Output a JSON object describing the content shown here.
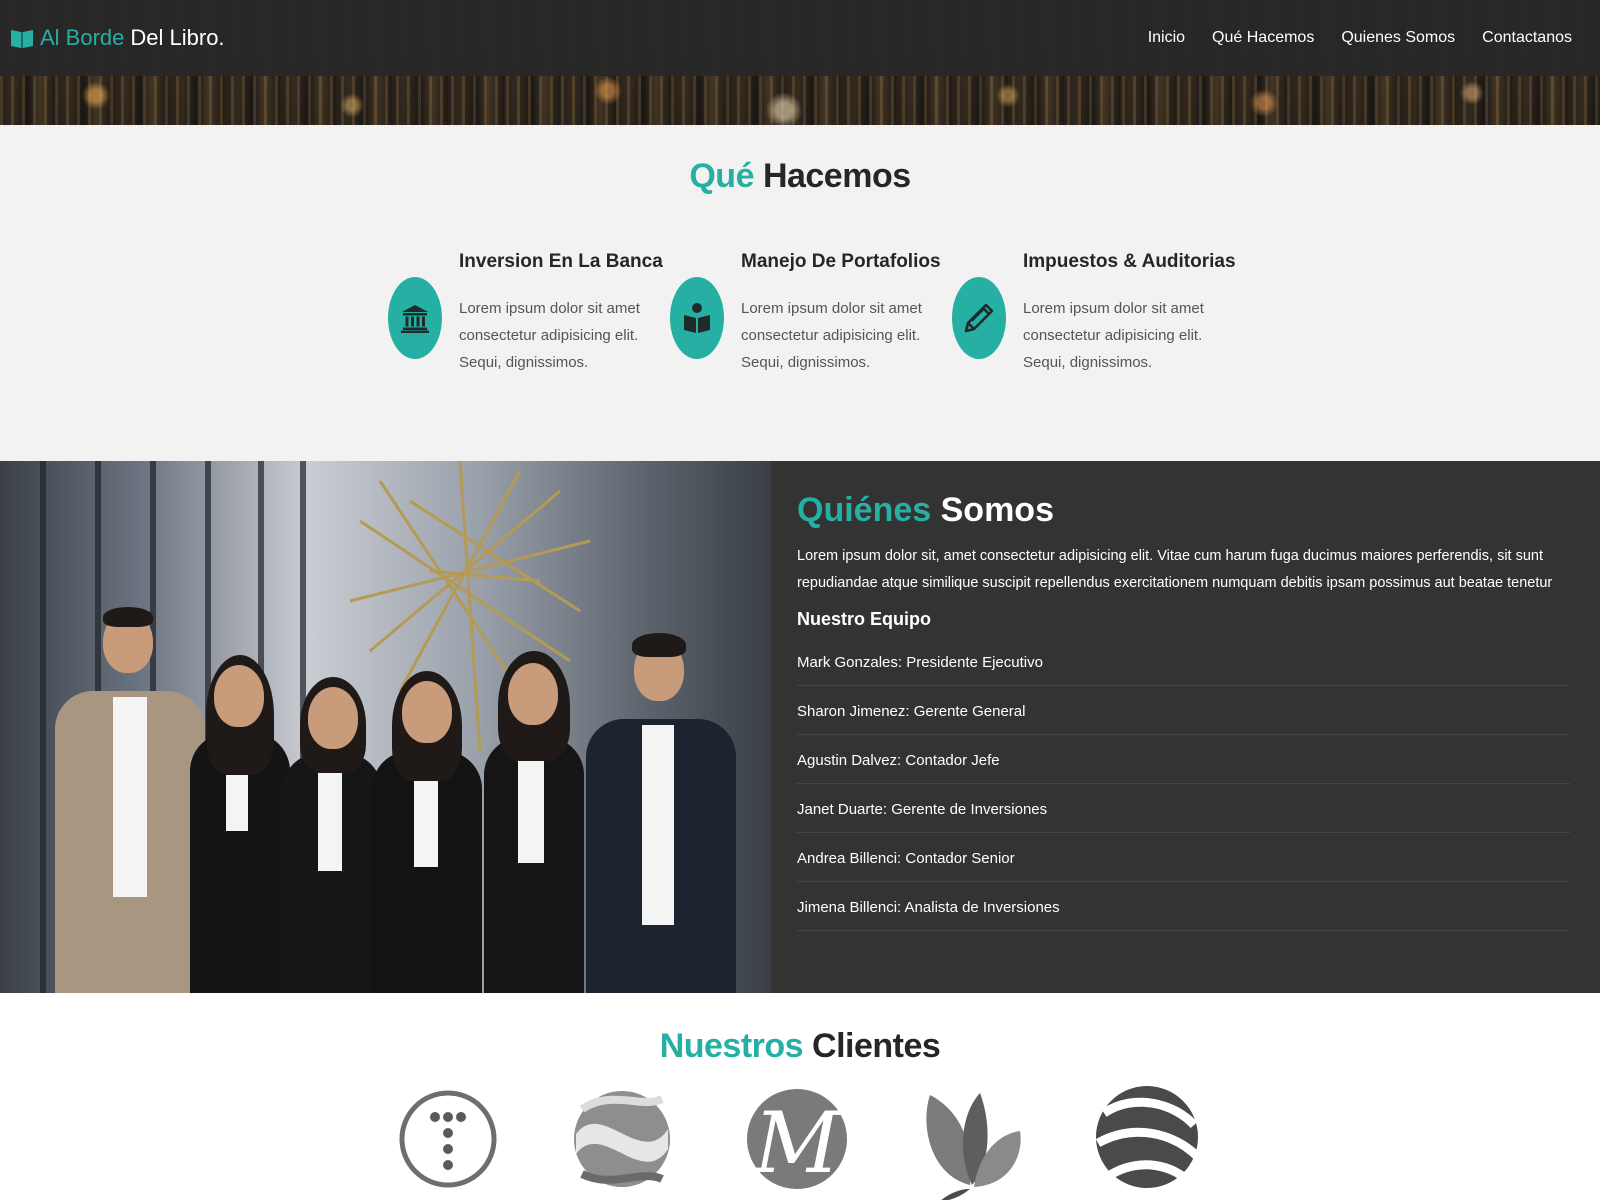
{
  "brand": {
    "accent": "Al Borde",
    "main": "Del Libro.",
    "icon": "open-book-icon"
  },
  "nav": {
    "items": [
      "Inicio",
      "Qué Hacemos",
      "Quienes Somos",
      "Contactanos"
    ]
  },
  "colors": {
    "accent": "#26b0a4",
    "navbar": "#282828",
    "about_bg": "#333333",
    "services_bg": "#f2f2f2"
  },
  "services": {
    "title_accent": "Qué",
    "title_main": "Hacemos",
    "items": [
      {
        "title": "Inversion En La Banca",
        "text": "Lorem ipsum dolor sit amet consectetur adipisicing elit. Sequi, dignissimos.",
        "icon": "bank-icon"
      },
      {
        "title": "Manejo De Portafolios",
        "text": "Lorem ipsum dolor sit amet consectetur adipisicing elit. Sequi, dignissimos.",
        "icon": "book-reader-icon"
      },
      {
        "title": "Impuestos & Auditorias",
        "text": "Lorem ipsum dolor sit amet consectetur adipisicing elit. Sequi, dignissimos.",
        "icon": "pencil-icon"
      }
    ]
  },
  "about": {
    "title_accent": "Quiénes",
    "title_main": "Somos",
    "text": "Lorem ipsum dolor sit, amet consectetur adipisicing elit. Vitae cum harum fuga ducimus maiores perferendis, sit sunt repudiandae atque similique suscipit repellendus exercitationem numquam debitis ipsam possimus aut beatae tenetur",
    "team_title": "Nuestro Equipo",
    "team": [
      "Mark Gonzales: Presidente Ejecutivo",
      "Sharon Jimenez: Gerente General",
      "Agustin Dalvez: Contador Jefe",
      "Janet Duarte: Gerente de Inversiones",
      "Andrea Billenci: Contador Senior",
      "Jimena Billenci: Analista de Inversiones"
    ]
  },
  "clients": {
    "title_accent": "Nuestros",
    "title_main": "Clientes",
    "logos": [
      "dots-t-logo",
      "swirl-sphere-logo",
      "m-letter-logo",
      "leaves-logo",
      "striped-sphere-logo"
    ]
  }
}
